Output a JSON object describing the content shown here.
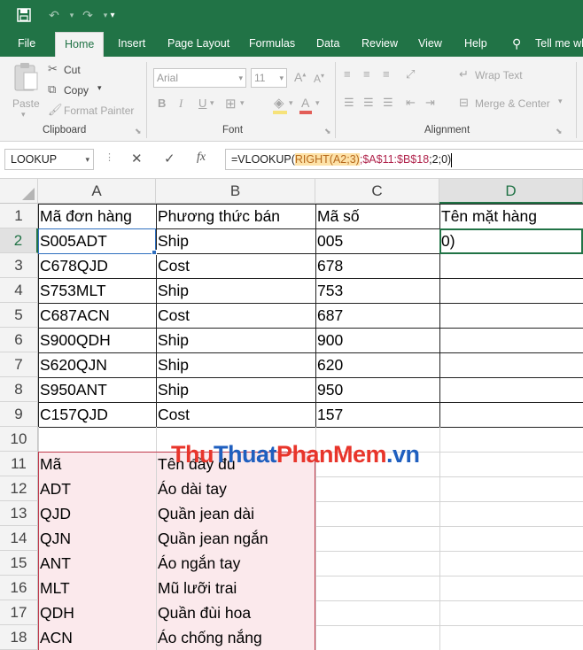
{
  "title_bar": {
    "icons": [
      "save-icon",
      "undo-icon",
      "redo-icon",
      "customize-qat-icon"
    ]
  },
  "tabs": [
    "File",
    "Home",
    "Insert",
    "Page Layout",
    "Formulas",
    "Data",
    "Review",
    "View",
    "Help",
    "Tell me wh"
  ],
  "active_tab": "Home",
  "ribbon": {
    "clipboard": {
      "paste": "Paste",
      "cut": "Cut",
      "copy": "Copy",
      "format_painter": "Format Painter",
      "label": "Clipboard"
    },
    "font": {
      "font_name": "Arial",
      "font_size": "11",
      "label": "Font",
      "bold": "B",
      "italic": "I",
      "underline": "U"
    },
    "alignment": {
      "wrap_text": "Wrap Text",
      "merge_center": "Merge & Center",
      "label": "Alignment"
    }
  },
  "formula_bar": {
    "name_box": "LOOKUP",
    "cancel_symbol": "✕",
    "enter_symbol": "✓",
    "fx": "fx",
    "formula_prefix": "=VLOOKUP(",
    "formula_highlight": "RIGHT(A2;3)",
    "formula_sep": ";",
    "formula_range": "$A$11:$B$18",
    "formula_suffix": ";2;0)"
  },
  "grid": {
    "columns": [
      "A",
      "B",
      "C",
      "D"
    ],
    "selected_column": "D",
    "selected_row": "2",
    "rows": [
      {
        "num": "1",
        "cells": [
          "Mã đơn hàng",
          "Phương thức bán",
          "Mã số",
          "Tên mặt hàng"
        ]
      },
      {
        "num": "2",
        "cells": [
          "S005ADT",
          "Ship",
          "005",
          "0)"
        ]
      },
      {
        "num": "3",
        "cells": [
          "C678QJD",
          "Cost",
          "678",
          ""
        ]
      },
      {
        "num": "4",
        "cells": [
          "S753MLT",
          "Ship",
          "753",
          ""
        ]
      },
      {
        "num": "5",
        "cells": [
          "C687ACN",
          "Cost",
          "687",
          ""
        ]
      },
      {
        "num": "6",
        "cells": [
          "S900QDH",
          "Ship",
          "900",
          ""
        ]
      },
      {
        "num": "7",
        "cells": [
          "S620QJN",
          "Ship",
          "620",
          ""
        ]
      },
      {
        "num": "8",
        "cells": [
          "S950ANT",
          "Ship",
          "950",
          ""
        ]
      },
      {
        "num": "9",
        "cells": [
          "C157QJD",
          "Cost",
          "157",
          ""
        ]
      },
      {
        "num": "10",
        "cells": [
          "",
          "",
          "",
          ""
        ]
      },
      {
        "num": "11",
        "cells": [
          "Mã",
          "Tên đầy đủ",
          "",
          ""
        ]
      },
      {
        "num": "12",
        "cells": [
          "ADT",
          "Áo dài tay",
          "",
          ""
        ]
      },
      {
        "num": "13",
        "cells": [
          "QJD",
          "Quần jean dài",
          "",
          ""
        ]
      },
      {
        "num": "14",
        "cells": [
          "QJN",
          "Quần jean ngắn",
          "",
          ""
        ]
      },
      {
        "num": "15",
        "cells": [
          "ANT",
          "Áo ngắn tay",
          "",
          ""
        ]
      },
      {
        "num": "16",
        "cells": [
          "MLT",
          "Mũ lưỡi trai",
          "",
          ""
        ]
      },
      {
        "num": "17",
        "cells": [
          "QDH",
          "Quần đùi hoa",
          "",
          ""
        ]
      },
      {
        "num": "18",
        "cells": [
          "ACN",
          "Áo chống nắng",
          "",
          ""
        ]
      }
    ]
  },
  "watermark": {
    "part1": "Thu",
    "part2": "Thuat",
    "part3": "PhanMem",
    "part4": ".vn",
    "color_main": "#e8352b",
    "color_alt": "#1f5fbf"
  },
  "colors": {
    "excel_green": "#217346",
    "range_pink": "#fbe9ec",
    "range_border": "#c0394b",
    "selected_border": "#217346"
  }
}
